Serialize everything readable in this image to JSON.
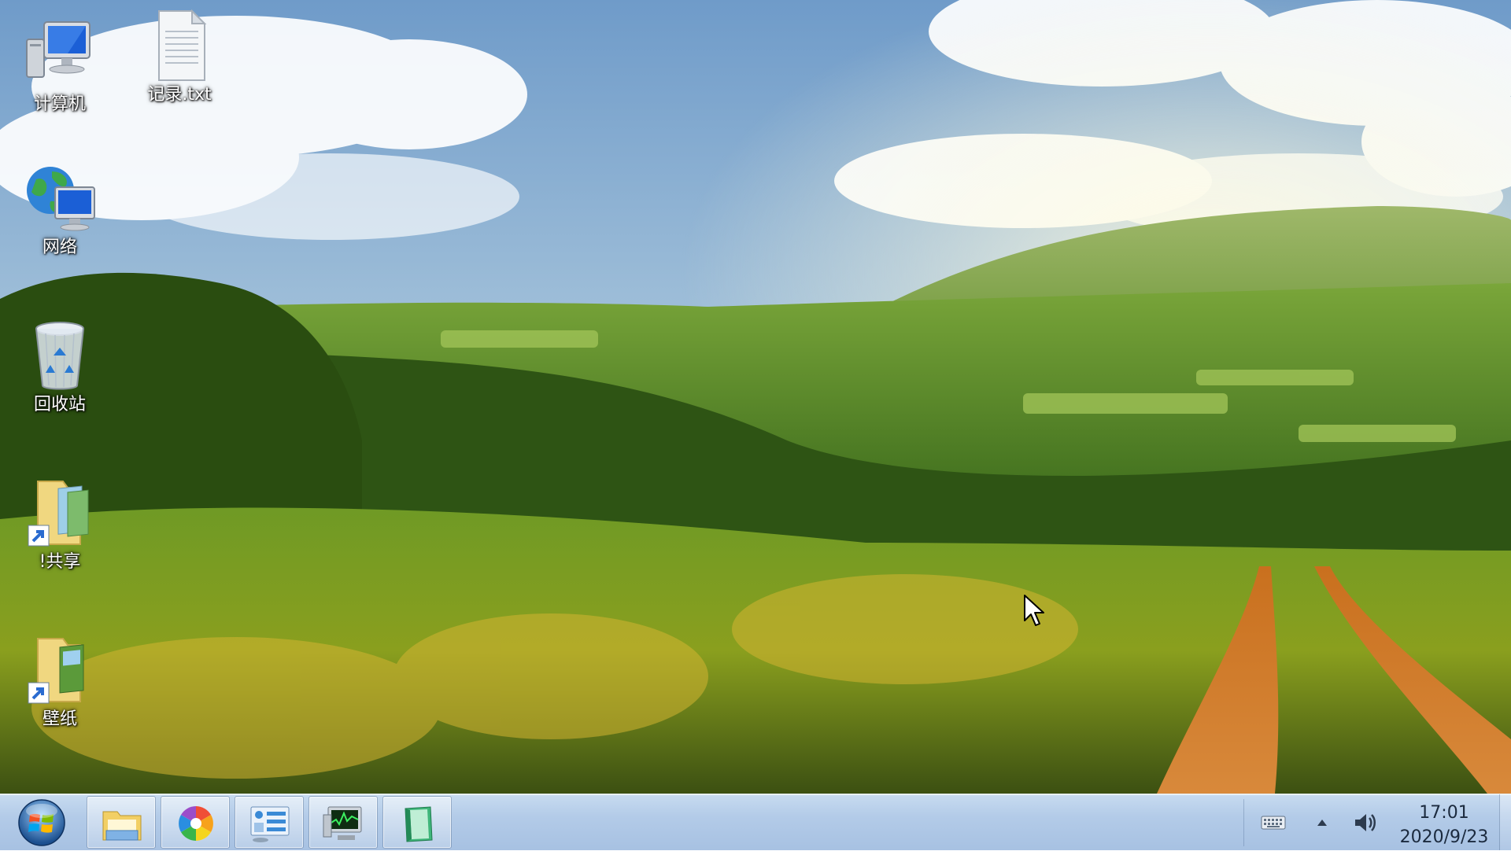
{
  "desktop": {
    "icons": [
      {
        "label": "计算机",
        "icon": "computer-icon"
      },
      {
        "label": "记录.txt",
        "icon": "text-file-icon"
      },
      {
        "label": "网络",
        "icon": "network-icon"
      },
      {
        "label": "回收站",
        "icon": "recycle-bin-icon"
      },
      {
        "label": "!共享",
        "icon": "shared-folder-shortcut-icon"
      },
      {
        "label": "壁纸",
        "icon": "wallpaper-folder-shortcut-icon"
      }
    ]
  },
  "taskbar": {
    "start": {
      "icon": "windows-start-orb-icon"
    },
    "pinned_apps": [
      {
        "icon": "file-explorer-icon"
      },
      {
        "icon": "color-pinwheel-app-icon"
      },
      {
        "icon": "control-panel-icon"
      },
      {
        "icon": "system-monitor-icon"
      },
      {
        "icon": "green-notebook-icon"
      }
    ],
    "tray": {
      "icons": [
        "keyboard-icon",
        "show-hidden-icons-arrow",
        "volume-icon"
      ],
      "time": "17:01",
      "date": "2020/9/23"
    }
  },
  "colors": {
    "taskbar": "#b3cbe8",
    "clock_text": "#1b2a3e",
    "icon_label": "#ffffff"
  }
}
